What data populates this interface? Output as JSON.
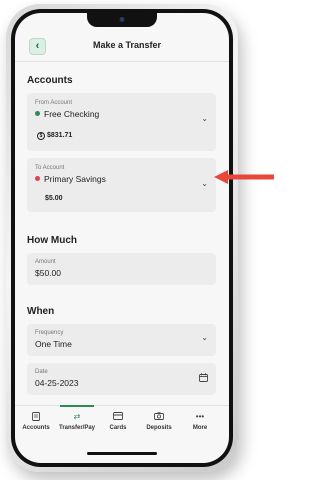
{
  "header": {
    "back_icon": "chevron-left-icon",
    "title": "Make a Transfer"
  },
  "accounts": {
    "section_title": "Accounts",
    "from": {
      "label": "From Account",
      "name": "Free Checking",
      "dot_color": "#2e8b57",
      "balance": "$831.71",
      "balance_icon": "dollar-circle-icon"
    },
    "to": {
      "label": "To Account",
      "name": "Primary Savings",
      "dot_color": "#e0434b",
      "balance": "$5.00"
    }
  },
  "how_much": {
    "section_title": "How Much",
    "amount_label": "Amount",
    "amount_value": "$50.00"
  },
  "when": {
    "section_title": "When",
    "frequency_label": "Frequency",
    "frequency_value": "One Time",
    "date_label": "Date",
    "date_value": "04-25-2023",
    "date_icon": "calendar-icon"
  },
  "tabbar": {
    "tabs": [
      {
        "label": "Accounts",
        "icon": "document-icon"
      },
      {
        "label": "Transfer/Pay",
        "icon": "transfer-arrows-icon",
        "active": true
      },
      {
        "label": "Cards",
        "icon": "card-icon"
      },
      {
        "label": "Deposits",
        "icon": "camera-icon"
      },
      {
        "label": "More",
        "icon": "ellipsis-icon"
      }
    ]
  },
  "accent_color": "#2e8b57",
  "callout_arrow_color": "#e8483c"
}
